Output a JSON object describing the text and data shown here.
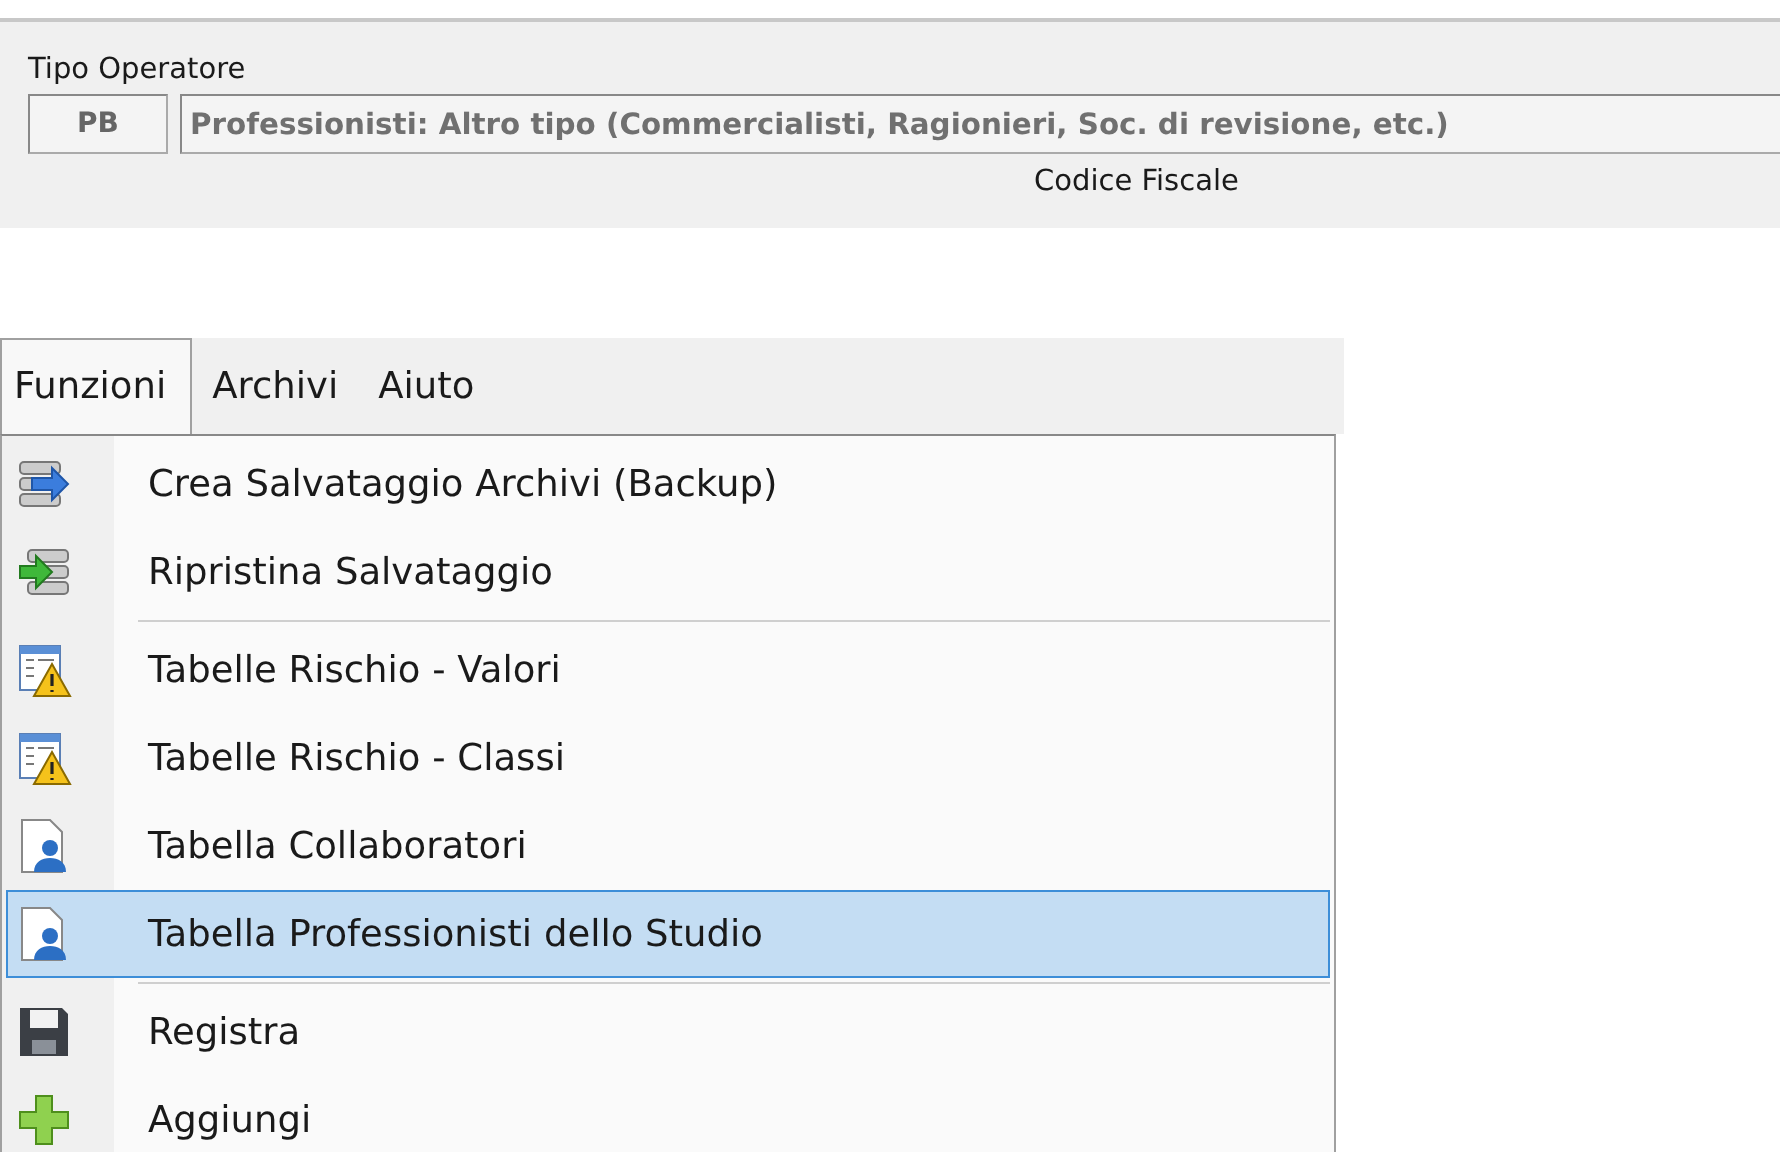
{
  "operator_panel": {
    "label": "Tipo Operatore",
    "code": "PB",
    "description": "Professionisti: Altro tipo (Commercialisti, Ragionieri, Soc. di revisione, etc.)",
    "next_label": "Codice Fiscale"
  },
  "menu_bar": [
    {
      "label": "Funzioni",
      "selected": true
    },
    {
      "label": "Archivi",
      "selected": false
    },
    {
      "label": "Aiuto",
      "selected": false
    }
  ],
  "menu": [
    {
      "kind": "backup",
      "label": "Crea Salvataggio Archivi (Backup)",
      "selected": false
    },
    {
      "kind": "restore",
      "label": "Ripristina Salvataggio",
      "selected": false
    },
    {
      "kind": "separator"
    },
    {
      "kind": "risk",
      "label": "Tabelle Rischio - Valori",
      "selected": false
    },
    {
      "kind": "risk",
      "label": "Tabelle Rischio - Classi",
      "selected": false
    },
    {
      "kind": "person",
      "label": "Tabella Collaboratori",
      "selected": false
    },
    {
      "kind": "person",
      "label": "Tabella Professionisti dello Studio",
      "selected": true
    },
    {
      "kind": "separator"
    },
    {
      "kind": "save",
      "label": "Registra",
      "selected": false
    },
    {
      "kind": "add",
      "label": "Aggiungi",
      "selected": false
    }
  ]
}
